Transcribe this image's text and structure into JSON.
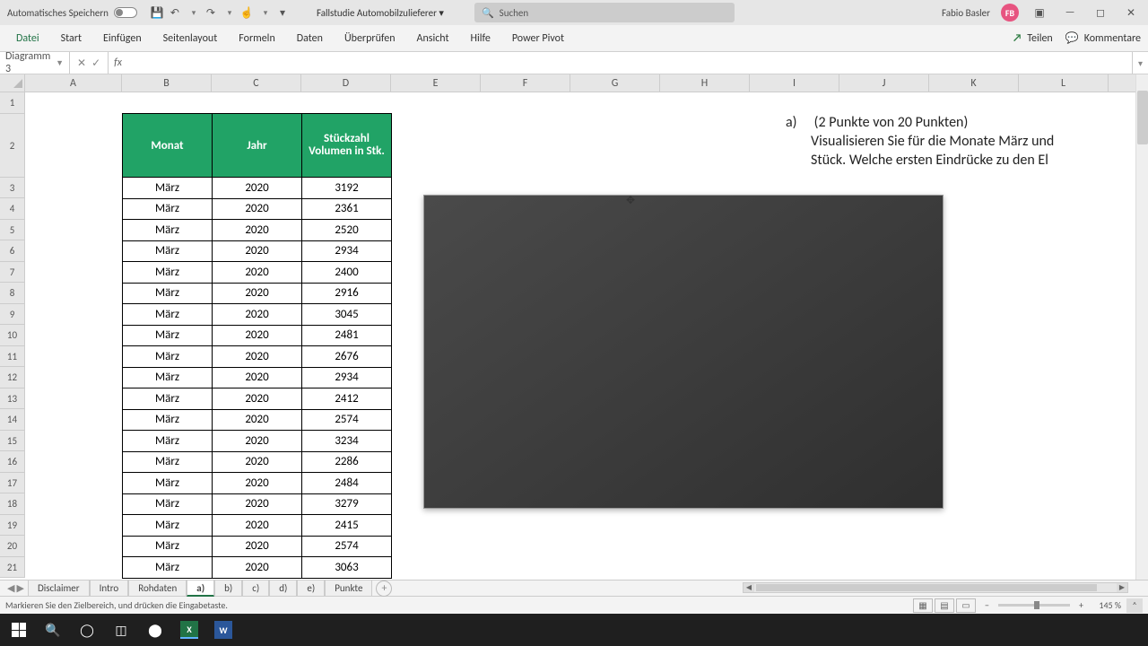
{
  "titlebar": {
    "autosave_label": "Automatisches Speichern",
    "doc_title": "Fallstudie Automobilzulieferer",
    "search_placeholder": "Suchen",
    "user_name": "Fabio Basler",
    "user_initials": "FB"
  },
  "ribbon": {
    "tabs": [
      "Datei",
      "Start",
      "Einfügen",
      "Seitenlayout",
      "Formeln",
      "Daten",
      "Überprüfen",
      "Ansicht",
      "Hilfe",
      "Power Pivot"
    ],
    "share": "Teilen",
    "comments": "Kommentare"
  },
  "formulabar": {
    "namebox": "Diagramm 3",
    "fx": "fx",
    "formula": ""
  },
  "columns": [
    "A",
    "B",
    "C",
    "D",
    "E",
    "F",
    "G",
    "H",
    "I",
    "J",
    "K",
    "L"
  ],
  "row_numbers": [
    1,
    2,
    3,
    4,
    5,
    6,
    7,
    8,
    9,
    10,
    11,
    12,
    13,
    14,
    15,
    16,
    17,
    18,
    19,
    20,
    21
  ],
  "table": {
    "headers": [
      "Monat",
      "Jahr",
      "Stückzahl Volumen in Stk."
    ],
    "rows": [
      [
        "März",
        "2020",
        "3192"
      ],
      [
        "März",
        "2020",
        "2361"
      ],
      [
        "März",
        "2020",
        "2520"
      ],
      [
        "März",
        "2020",
        "2934"
      ],
      [
        "März",
        "2020",
        "2400"
      ],
      [
        "März",
        "2020",
        "2916"
      ],
      [
        "März",
        "2020",
        "3045"
      ],
      [
        "März",
        "2020",
        "2481"
      ],
      [
        "März",
        "2020",
        "2676"
      ],
      [
        "März",
        "2020",
        "2934"
      ],
      [
        "März",
        "2020",
        "2412"
      ],
      [
        "März",
        "2020",
        "2574"
      ],
      [
        "März",
        "2020",
        "3234"
      ],
      [
        "März",
        "2020",
        "2286"
      ],
      [
        "März",
        "2020",
        "2484"
      ],
      [
        "März",
        "2020",
        "3279"
      ],
      [
        "März",
        "2020",
        "2415"
      ],
      [
        "März",
        "2020",
        "2574"
      ],
      [
        "März",
        "2020",
        "3063"
      ]
    ]
  },
  "task": {
    "label": "a)",
    "line1": "(2 Punkte von 20 Punkten)",
    "line2": "Visualisieren Sie für die Monate März und",
    "line3": "Stück. Welche ersten Eindrücke zu den El"
  },
  "sheets": {
    "tabs": [
      "Disclaimer",
      "Intro",
      "Rohdaten",
      "a)",
      "b)",
      "c)",
      "d)",
      "e)",
      "Punkte"
    ],
    "active": "a)"
  },
  "statusbar": {
    "msg": "Markieren Sie den Zielbereich, und drücken die Eingabetaste.",
    "zoom": "145 %"
  },
  "chart_data": {
    "type": "bar",
    "categories": [],
    "values": [],
    "title": "",
    "xlabel": "",
    "ylabel": ""
  }
}
